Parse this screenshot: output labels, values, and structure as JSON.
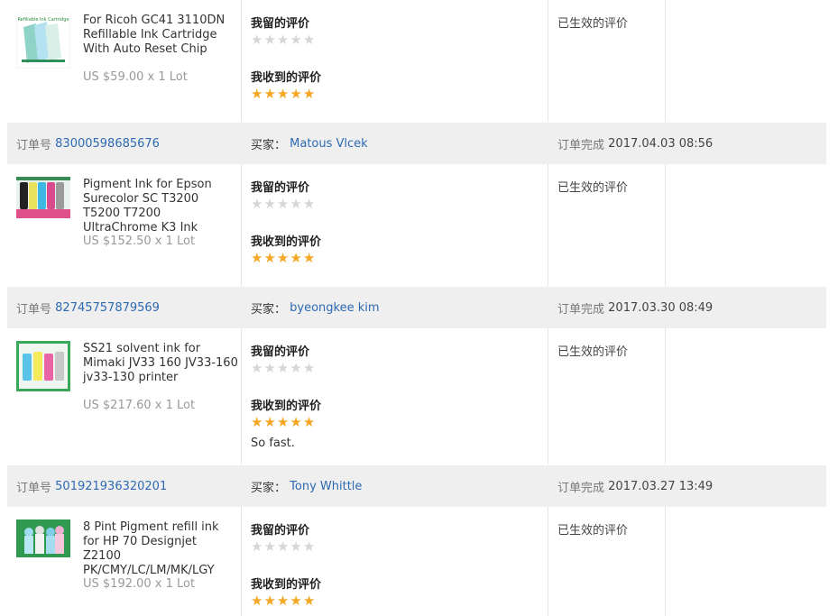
{
  "orders": [
    {
      "product": {
        "title": "For Ricoh GC41 3110DN Refillable Ink Cartridge With Auto Reset Chip",
        "price": "US $59.00 x 1 Lot",
        "thumb_icon": "ink-cartridge-thumbnail"
      },
      "given_feedback_label": "我留的评价",
      "given_rating": 0,
      "received_feedback_label": "我收到的评价",
      "received_rating": 5,
      "comment": "",
      "status": "已生效的评价"
    },
    {
      "header": {
        "order_label": "订单号",
        "order_no": "83000598685676",
        "buyer_label": "买家：",
        "buyer": "Matous Vlcek",
        "done_label": "订单完成",
        "done_time": "2017.04.03 08:56"
      },
      "product": {
        "title": "Pigment Ink for Epson Surecolor SC T3200 T5200 T7200 UltraChrome K3 Ink",
        "price": "US $152.50 x 1 Lot",
        "thumb_icon": "ink-bottles-thumbnail"
      },
      "given_feedback_label": "我留的评价",
      "given_rating": 0,
      "received_feedback_label": "我收到的评价",
      "received_rating": 5,
      "comment": "",
      "status": "已生效的评价"
    },
    {
      "header": {
        "order_label": "订单号",
        "order_no": "82745757879569",
        "buyer_label": "买家：",
        "buyer": "byeongkee kim",
        "done_label": "订单完成",
        "done_time": "2017.03.30 08:49"
      },
      "product": {
        "title": "SS21 solvent ink for Mimaki JV33 160 JV33-160 jv33-130 printer",
        "price": "US $217.60 x 1 Lot",
        "thumb_icon": "solvent-ink-thumbnail"
      },
      "given_feedback_label": "我留的评价",
      "given_rating": 0,
      "received_feedback_label": "我收到的评价",
      "received_rating": 5,
      "comment": "So fast.",
      "status": "已生效的评价"
    },
    {
      "header": {
        "order_label": "订单号",
        "order_no": "501921936320201",
        "buyer_label": "买家：",
        "buyer": "Tony Whittle",
        "done_label": "订单完成",
        "done_time": "2017.03.27 13:49"
      },
      "product": {
        "title": "8 Pint Pigment refill ink for HP 70 Designjet Z2100 PK/CMY/LC/LM/MK/LGY",
        "price": "US $192.00 x 1 Lot",
        "thumb_icon": "refill-ink-thumbnail"
      },
      "given_feedback_label": "我留的评价",
      "given_rating": 0,
      "received_feedback_label": "我收到的评价",
      "received_rating": 5,
      "comment": "",
      "status": "已生效的评价"
    }
  ],
  "colors": {
    "star_full": "#f5a623",
    "star_empty": "#d6d6d6",
    "link": "#2d6ab3",
    "header_bg": "#efefef"
  }
}
